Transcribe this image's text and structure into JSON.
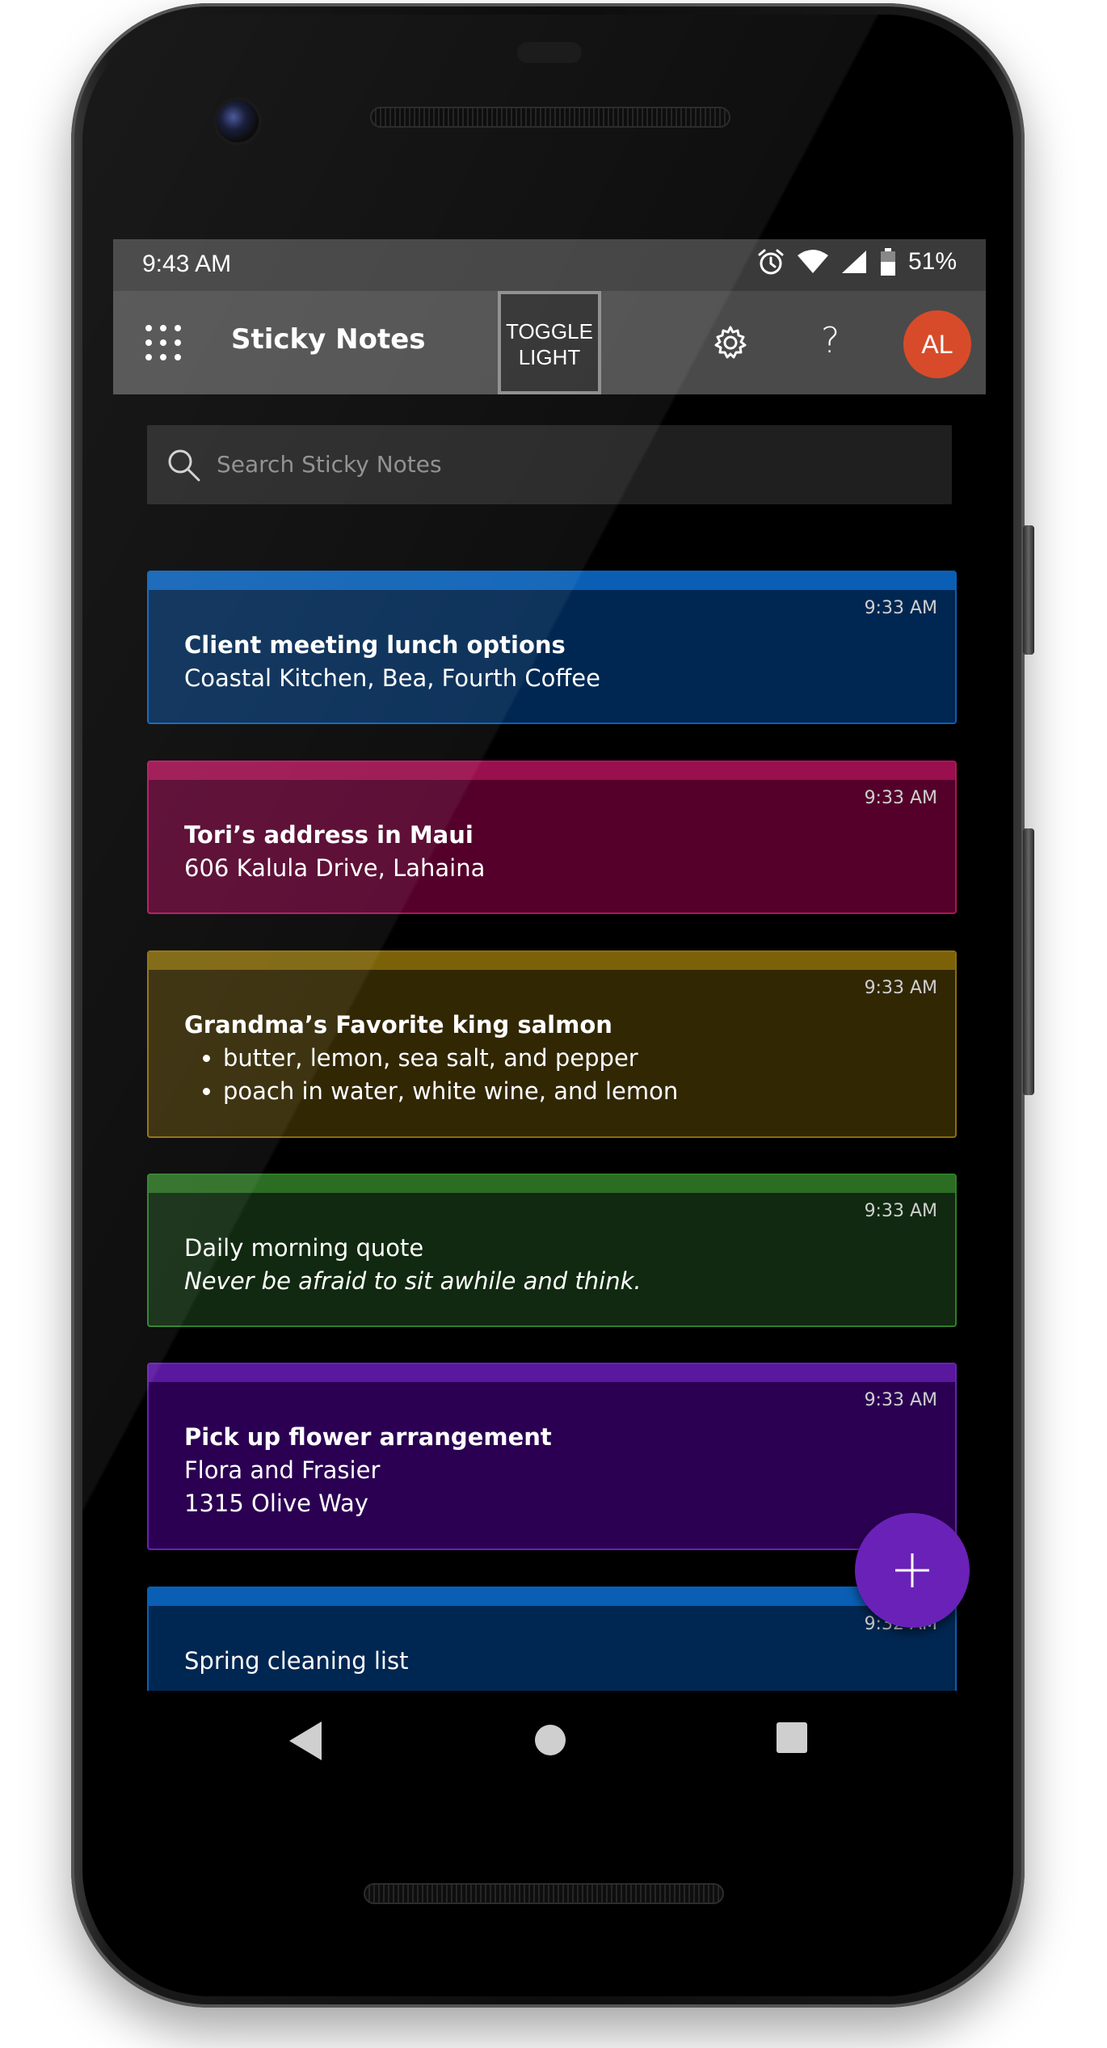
{
  "status_bar": {
    "time": "9:43 AM",
    "battery": "51%",
    "icons": [
      "alarm-icon",
      "wifi-icon",
      "signal-icon",
      "battery-icon"
    ]
  },
  "app_bar": {
    "title": "Sticky Notes",
    "toggle_line1": "TOGGLE",
    "toggle_line2": "LIGHT",
    "avatar_initials": "AL",
    "avatar_color": "#d84b2a"
  },
  "search": {
    "placeholder": "Search Sticky Notes"
  },
  "notes": [
    {
      "color": "blue",
      "time": "9:33 AM",
      "title": "Client meeting lunch options",
      "lines": [
        "Coastal Kitchen, Bea, Fourth Coffee"
      ]
    },
    {
      "color": "pink",
      "time": "9:33 AM",
      "title": "Tori’s address in Maui",
      "lines": [
        "606 Kalula Drive, Lahaina"
      ]
    },
    {
      "color": "yellow",
      "time": "9:33 AM",
      "title": "Grandma’s Favorite king salmon",
      "bullets": [
        "butter, lemon, sea salt, and pepper",
        "poach in water, white wine, and lemon"
      ]
    },
    {
      "color": "green",
      "time": "9:33 AM",
      "lines": [
        "Daily morning quote"
      ],
      "italic_line": "Never be afraid to sit awhile and think."
    },
    {
      "color": "purple",
      "time": "9:33 AM",
      "title": "Pick up flower arrangement",
      "lines": [
        "Flora and Frasier",
        "1315 Olive Way"
      ]
    },
    {
      "color": "blue",
      "time": "9:32 AM",
      "lines": [
        "Spring cleaning list"
      ]
    }
  ],
  "colors": {
    "fab": "#6a21b8",
    "app_bar": "#4a4a4a",
    "status_bar": "#3a3a3a"
  }
}
